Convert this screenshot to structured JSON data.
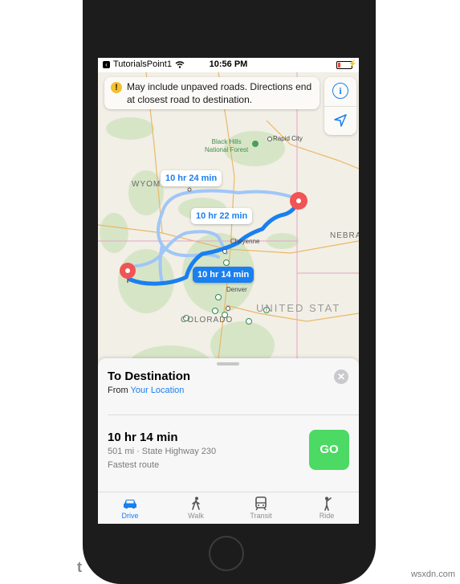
{
  "watermark": "wsxdn.com",
  "status_bar": {
    "carrier": "TutorialsPoint1",
    "time": "10:56 PM"
  },
  "banner": {
    "text": "May include unpaved roads. Directions end at closest road to destination."
  },
  "map": {
    "labels": {
      "wyoming": "WYOM",
      "nebraska": "NEBRA",
      "colorado": "COLORADO",
      "united_states": "UNITED STAT",
      "denver": "Denver",
      "cheyenne": "Cheyenne",
      "rapid_city": "Rapid City",
      "black_hills_1": "Black Hills",
      "black_hills_2": "National Forest"
    },
    "route_labels": {
      "alt1": "10 hr 24 min",
      "alt2": "10 hr 22 min",
      "main": "10 hr 14 min"
    },
    "colors": {
      "main_route": "#1a7ff0",
      "alt_route": "#9fc6f7",
      "pin": "#f05454"
    }
  },
  "sheet": {
    "title": "To Destination",
    "from_prefix": "From",
    "from_link": "Your Location",
    "route": {
      "time": "10 hr 14 min",
      "details": "501 mi · State Highway 230",
      "note": "Fastest route"
    },
    "go_label": "GO"
  },
  "tabs": [
    {
      "label": "Drive",
      "icon": "car-icon",
      "active": true
    },
    {
      "label": "Walk",
      "icon": "walk-icon",
      "active": false
    },
    {
      "label": "Transit",
      "icon": "transit-icon",
      "active": false
    },
    {
      "label": "Ride",
      "icon": "ride-icon",
      "active": false
    }
  ]
}
